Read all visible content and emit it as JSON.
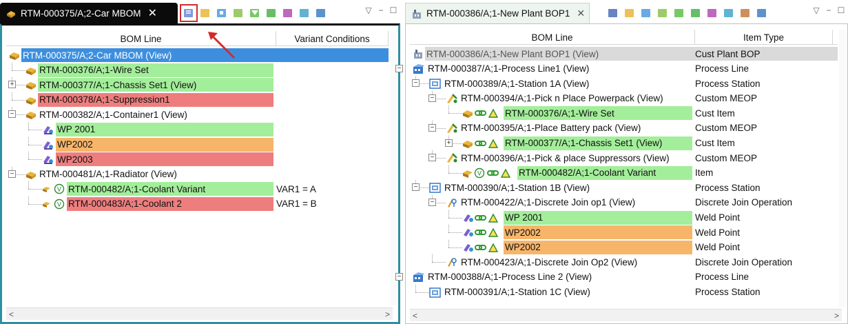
{
  "left": {
    "tab_title": "RTM-000375/A;2-Car MBOM",
    "tab_close": "✕",
    "columns": [
      "BOM Line",
      "Variant Conditions"
    ],
    "rows": [
      {
        "label": "RTM-000375/A;2-Car MBOM (View)",
        "col2": "",
        "depth": 0,
        "bg": "select",
        "icon": "assembly-icon",
        "expander": ""
      },
      {
        "label": "RTM-000376/A;1-Wire Set",
        "col2": "",
        "depth": 1,
        "bg": "green",
        "icon": "assembly-icon",
        "expander": ""
      },
      {
        "label": "RTM-000377/A;1-Chassis Set1 (View)",
        "col2": "",
        "depth": 1,
        "bg": "green",
        "icon": "assembly-icon",
        "expander": "+"
      },
      {
        "label": "RTM-000378/A;1-Suppression1",
        "col2": "",
        "depth": 1,
        "bg": "red",
        "icon": "assembly-icon",
        "expander": ""
      },
      {
        "label": "RTM-000382/A;1-Container1 (View)",
        "col2": "",
        "depth": 1,
        "bg": "",
        "icon": "assembly-icon",
        "expander": "−"
      },
      {
        "label": "WP 2001",
        "col2": "",
        "depth": 2,
        "bg": "green",
        "icon": "weld-icon",
        "expander": ""
      },
      {
        "label": "WP2002",
        "col2": "",
        "depth": 2,
        "bg": "orange",
        "icon": "weld-icon",
        "expander": ""
      },
      {
        "label": "WP2003",
        "col2": "",
        "depth": 2,
        "bg": "red",
        "icon": "weld-icon",
        "expander": ""
      },
      {
        "label": "RTM-000481/A;1-Radiator (View)",
        "col2": "",
        "depth": 1,
        "bg": "",
        "icon": "assembly-icon",
        "expander": "−"
      },
      {
        "label": "RTM-000482/A;1-Coolant Variant",
        "col2": "VAR1 = A",
        "depth": 2,
        "bg": "green",
        "icon": "variant-icon",
        "expander": ""
      },
      {
        "label": "RTM-000483/A;1-Coolant 2",
        "col2": "VAR1 = B",
        "depth": 2,
        "bg": "red",
        "icon": "variant-icon",
        "expander": ""
      }
    ]
  },
  "right": {
    "tab_title": "RTM-000386/A;1-New Plant BOP1",
    "tab_close": "✕",
    "columns": [
      "BOM Line",
      "Item Type"
    ],
    "rows": [
      {
        "label": "RTM-000386/A;1-New Plant BOP1 (View)",
        "col2": "Cust Plant BOP",
        "depth": 0,
        "bg": "grey",
        "icon": "plant-icon",
        "expander": ""
      },
      {
        "label": "RTM-000387/A;1-Process Line1 (View)",
        "col2": "Process Line",
        "depth": 0,
        "bg": "",
        "icon": "process-line-icon",
        "expander": "−"
      },
      {
        "label": "RTM-000389/A;1-Station 1A (View)",
        "col2": "Process Station",
        "depth": 1,
        "bg": "",
        "icon": "station-icon",
        "expander": "−"
      },
      {
        "label": "RTM-000394/A;1-Pick n Place Powerpack (View)",
        "col2": "Custom MEOP",
        "depth": 2,
        "bg": "",
        "icon": "operation-icon",
        "expander": "−"
      },
      {
        "label": "RTM-000376/A;1-Wire Set",
        "col2": "Cust Item",
        "depth": 3,
        "bg": "green",
        "icon": "assigned-assembly-icon",
        "expander": ""
      },
      {
        "label": "RTM-000395/A;1-Place Battery pack (View)",
        "col2": "Custom MEOP",
        "depth": 2,
        "bg": "",
        "icon": "operation-icon",
        "expander": "−"
      },
      {
        "label": "RTM-000377/A;1-Chassis Set1 (View)",
        "col2": "Cust Item",
        "depth": 3,
        "bg": "green",
        "icon": "assigned-assembly-icon",
        "expander": "+"
      },
      {
        "label": "RTM-000396/A;1-Pick & place Suppressors (View)",
        "col2": "Custom MEOP",
        "depth": 2,
        "bg": "",
        "icon": "operation-icon",
        "expander": "−"
      },
      {
        "label": "RTM-000482/A;1-Coolant Variant",
        "col2": "Item",
        "depth": 3,
        "bg": "green",
        "icon": "assigned-variant-icon",
        "expander": ""
      },
      {
        "label": "RTM-000390/A;1-Station 1B (View)",
        "col2": "Process Station",
        "depth": 1,
        "bg": "",
        "icon": "station-icon",
        "expander": "−"
      },
      {
        "label": "RTM-000422/A;1-Discrete Join op1 (View)",
        "col2": "Discrete Join Operation",
        "depth": 2,
        "bg": "",
        "icon": "join-op-icon",
        "expander": "−"
      },
      {
        "label": "WP 2001",
        "col2": "Weld Point",
        "depth": 3,
        "bg": "green",
        "icon": "assigned-weld-icon",
        "expander": ""
      },
      {
        "label": "WP2002",
        "col2": "Weld Point",
        "depth": 3,
        "bg": "orange",
        "icon": "assigned-weld-icon",
        "expander": ""
      },
      {
        "label": "WP2002",
        "col2": "Weld Point",
        "depth": 3,
        "bg": "orange",
        "icon": "assigned-weld-icon",
        "expander": ""
      },
      {
        "label": "RTM-000423/A;1-Discrete Join Op2 (View)",
        "col2": "Discrete Join Operation",
        "depth": 2,
        "bg": "",
        "icon": "join-op-icon",
        "expander": ""
      },
      {
        "label": "RTM-000388/A;1-Process Line 2 (View)",
        "col2": "Process Line",
        "depth": 0,
        "bg": "",
        "icon": "process-line-icon",
        "expander": "−"
      },
      {
        "label": "RTM-000391/A;1-Station 1C (View)",
        "col2": "Process Station",
        "depth": 1,
        "bg": "",
        "icon": "station-icon",
        "expander": ""
      }
    ]
  },
  "scroll": {
    "left_arrow": "<",
    "right_arrow": ">"
  },
  "colors": {
    "green": "#a3ee9a",
    "red": "#ee7e7e",
    "orange": "#f7b56a",
    "select": "#3d8fde",
    "accent_frame": "#2e8fa0",
    "highlight": "#d42a2a"
  }
}
